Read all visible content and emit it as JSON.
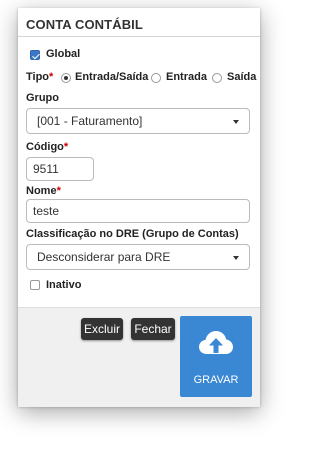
{
  "header": {
    "title": "CONTA CONTÁBIL"
  },
  "form": {
    "global": {
      "label": "Global",
      "checked": true
    },
    "tipo": {
      "label": "Tipo",
      "required_mark": "*",
      "options": [
        {
          "label": "Entrada/Saída",
          "checked": true
        },
        {
          "label": "Entrada",
          "checked": false
        },
        {
          "label": "Saída",
          "checked": false
        }
      ]
    },
    "grupo": {
      "label": "Grupo",
      "value": "[001 - Faturamento]"
    },
    "codigo": {
      "label": "Código",
      "required_mark": "*",
      "value": "9511"
    },
    "nome": {
      "label": "Nome",
      "required_mark": "*",
      "value": "teste"
    },
    "classificacao": {
      "label": "Classificação no DRE (Grupo de Contas)",
      "value": "Desconsiderar para DRE"
    },
    "inativo": {
      "label": "Inativo",
      "checked": false
    }
  },
  "footer": {
    "excluir_label": "Excluir",
    "fechar_label": "Fechar",
    "gravar_label": "GRAVAR",
    "gravar_icon": "cloud-upload-icon"
  },
  "colors": {
    "primary": "#3a87d4",
    "dark_button": "#333333",
    "required": "#cc0000"
  }
}
